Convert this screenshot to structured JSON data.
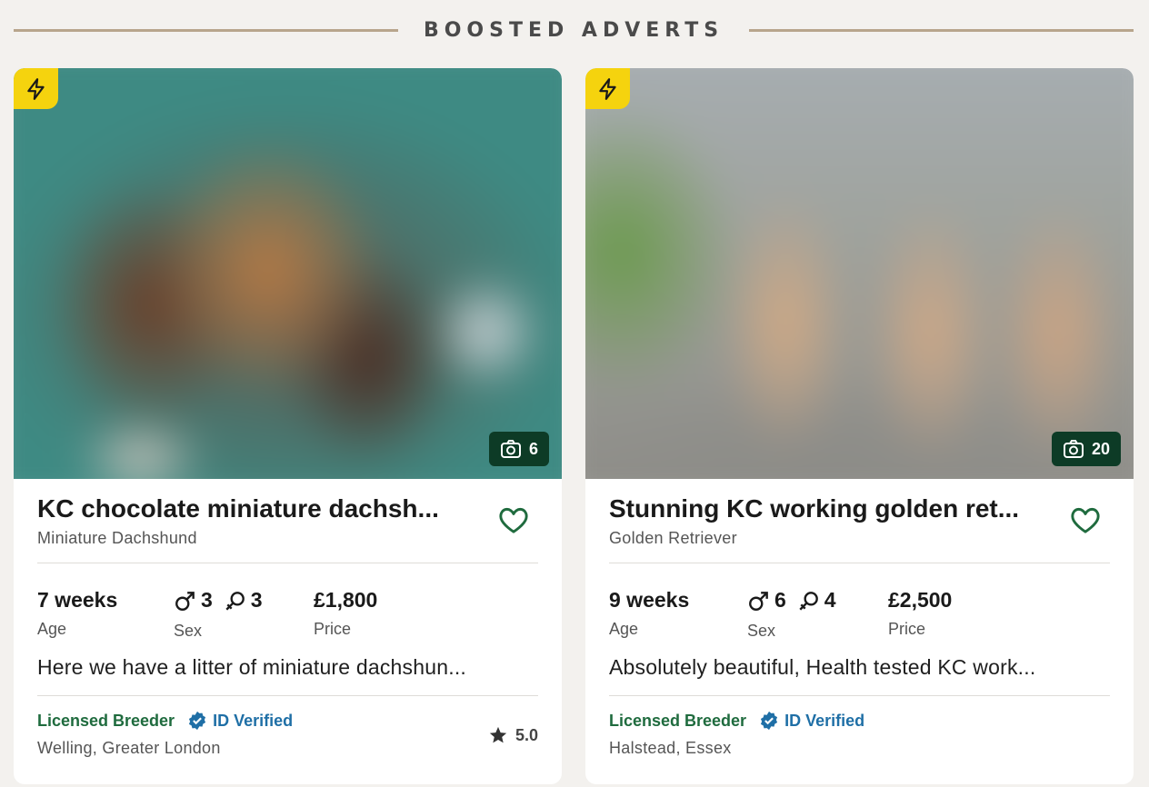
{
  "section": {
    "title": "BOOSTED ADVERTS"
  },
  "colors": {
    "boost": "#f5d30e",
    "licensed": "#1f6b3e",
    "verified": "#1f6fa6",
    "count_bg": "#0d3b26"
  },
  "adverts": [
    {
      "photo_count": "6",
      "headline": "KC chocolate miniature dachsh...",
      "breed": "Miniature Dachshund",
      "age_value": "7 weeks",
      "age_label": "Age",
      "male_count": "3",
      "female_count": "3",
      "sex_label": "Sex",
      "price_value": "£1,800",
      "price_label": "Price",
      "description": "Here we have a litter of miniature dachshun...",
      "licensed_label": "Licensed Breeder",
      "verified_label": "ID Verified",
      "location": "Welling, Greater London",
      "rating": "5.0"
    },
    {
      "photo_count": "20",
      "headline": "Stunning KC working golden ret...",
      "breed": "Golden Retriever",
      "age_value": "9 weeks",
      "age_label": "Age",
      "male_count": "6",
      "female_count": "4",
      "sex_label": "Sex",
      "price_value": "£2,500",
      "price_label": "Price",
      "description": "Absolutely beautiful, Health tested KC work...",
      "licensed_label": "Licensed Breeder",
      "verified_label": "ID Verified",
      "location": "Halstead, Essex"
    }
  ]
}
